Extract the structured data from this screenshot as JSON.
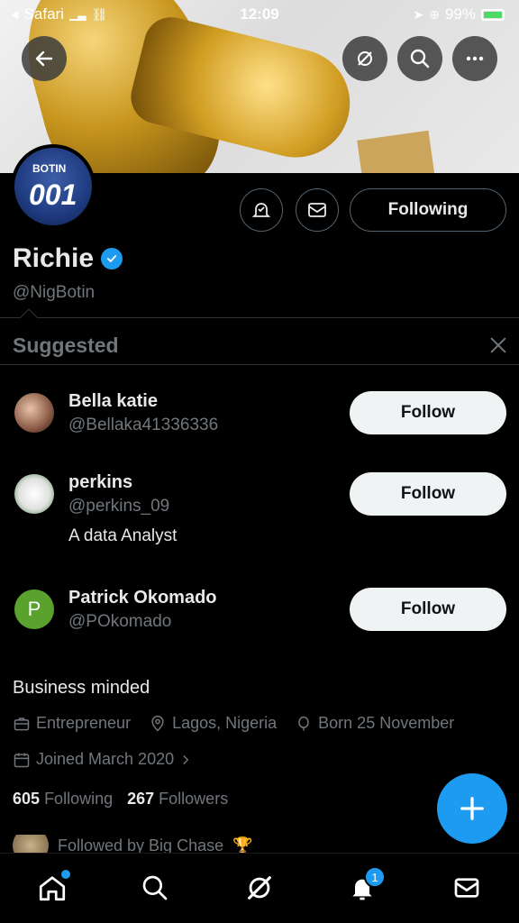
{
  "status_bar": {
    "carrier": "Safari",
    "time": "12:09",
    "battery": "99%"
  },
  "profile": {
    "name": "Richie",
    "handle": "@NigBotin",
    "avatar_text_top": "BOTIN",
    "avatar_text_number": "001",
    "following_button": "Following",
    "bio": "Business minded",
    "profession": "Entrepreneur",
    "location": "Lagos, Nigeria",
    "birthday": "Born 25 November",
    "joined": "Joined March 2020",
    "following_count": "605",
    "following_label": "Following",
    "followers_count": "267",
    "followers_label": "Followers",
    "followed_by": "Followed by Big Chase"
  },
  "suggested": {
    "title": "Suggested",
    "items": [
      {
        "name": "Bella katie",
        "handle": "@Bellaka41336336",
        "bio": "",
        "button": "Follow"
      },
      {
        "name": "perkins",
        "handle": "@perkins_09",
        "bio": "A data Analyst",
        "button": "Follow"
      },
      {
        "name": "Patrick Okomado",
        "handle": "@POkomado",
        "bio": "",
        "button": "Follow",
        "avatar_letter": "P"
      }
    ]
  },
  "nav": {
    "notification_count": "1"
  },
  "colors": {
    "accent": "#1d9bf0",
    "background": "#000000",
    "secondary_text": "#71767b"
  }
}
